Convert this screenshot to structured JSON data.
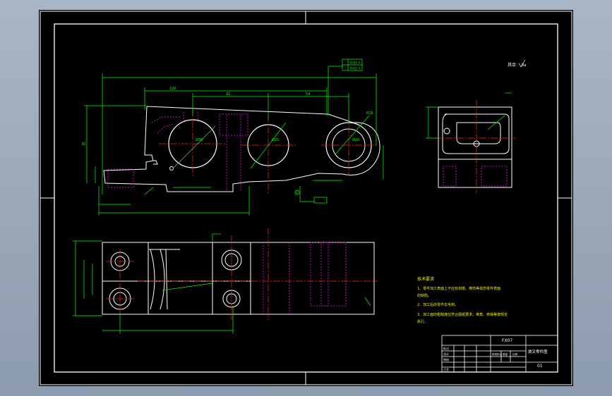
{
  "drawing": {
    "roughness_symbol": "Ra",
    "roughness_note": "其余",
    "tolerance_frame": [
      "0.01 A",
      "0.02 A"
    ],
    "datum_label": "A",
    "dimension_values": [
      "120",
      "42",
      "54",
      "30",
      "R16",
      "Ø30",
      "Ø25",
      "Ø20"
    ],
    "title_block": {
      "part_code": "FX07",
      "title": "拨叉零件图",
      "sheet": "01",
      "row_labels": [
        "标记",
        "设计",
        "审核",
        "工艺"
      ],
      "col_labels": [
        "阶段标记",
        "重量",
        "比例"
      ]
    },
    "tech_requirements": {
      "heading": "技术要求",
      "items": [
        "1、零件加工表面上不应有划痕、擦伤等损伤零件表面",
        "   的缺陷。",
        "2、加工后的零件去毛刺。",
        "3、加工面的粗糙度应符合图纸要求，倒角、修缘等按规定",
        "   执行。"
      ]
    }
  },
  "colors": {
    "sheet_bg": "#000000",
    "border": "#ffffff",
    "outline": "#ffffff",
    "dimension": "#00ff00",
    "centerline": "#ff2020",
    "hidden": "#ff00ff",
    "note_text": "#f0f000"
  }
}
